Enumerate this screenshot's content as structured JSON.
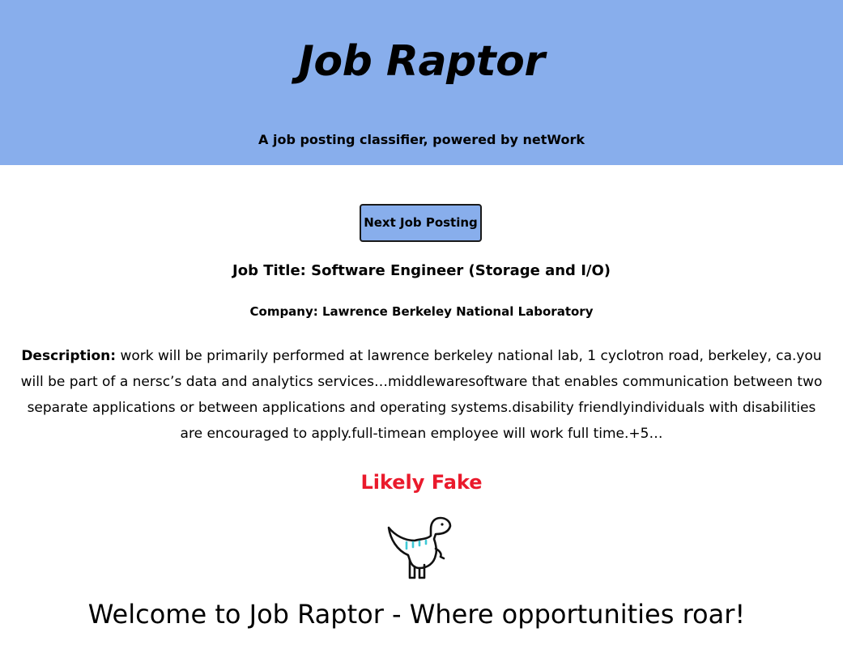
{
  "header": {
    "title": "Job Raptor",
    "subtitle": "A job posting classifier, powered by netWork"
  },
  "actions": {
    "next_label": "Next Job Posting"
  },
  "posting": {
    "title": "Job Title: Software Engineer (Storage and I/O)",
    "company": "Company: Lawrence Berkeley National Laboratory",
    "description_label": "Description:",
    "description_text": " work will be primarily performed at lawrence berkeley national lab, 1 cyclotron road, berkeley, ca.you will be part of a nersc’s data and analytics services…middlewaresoftware that enables communication between two separate applications or between applications and operating systems.disability friendlyindividuals with disabilities are encouraged to apply.full-timean employee will work full time.+5…"
  },
  "result": {
    "verdict": "Likely Fake",
    "verdict_color": "#ea1a2c",
    "icon": "dinosaur-icon"
  },
  "footer": {
    "welcome": "Welcome to Job Raptor - Where opportunities roar!"
  },
  "colors": {
    "header_bg": "#88aeec",
    "button_bg": "#88aeec",
    "dino_accent": "#3fc9d6"
  }
}
